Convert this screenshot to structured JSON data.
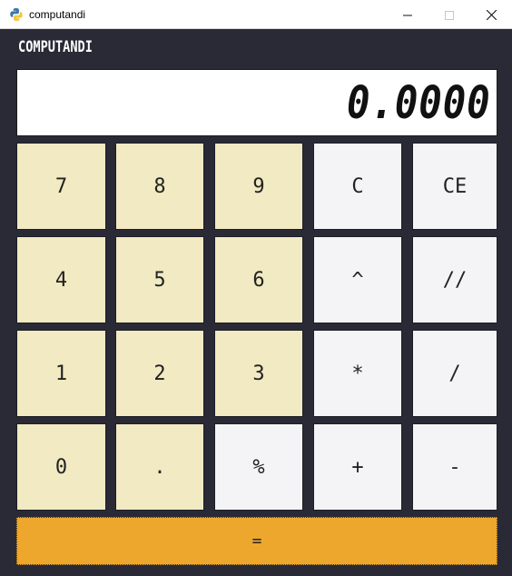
{
  "window": {
    "title": "computandi"
  },
  "brand": "COMPUTANDI",
  "display": {
    "value": "0.0000"
  },
  "keys": {
    "k7": "7",
    "k8": "8",
    "k9": "9",
    "clear": "C",
    "clear_entry": "CE",
    "k4": "4",
    "k5": "5",
    "k6": "6",
    "power": "^",
    "floor_div": "//",
    "k1": "1",
    "k2": "2",
    "k3": "3",
    "multiply": "*",
    "divide": "/",
    "k0": "0",
    "decimal": ".",
    "percent": "%",
    "plus": "+",
    "minus": "-",
    "equals": "="
  },
  "colors": {
    "background": "#2a2a36",
    "number_key": "#f1eac2",
    "operator_key": "#f4f4f6",
    "equals_key": "#eda72d",
    "display": "#ffffff"
  },
  "icons": {
    "app": "python-icon",
    "minimize": "minimize-icon",
    "maximize": "maximize-icon",
    "close": "close-icon"
  }
}
